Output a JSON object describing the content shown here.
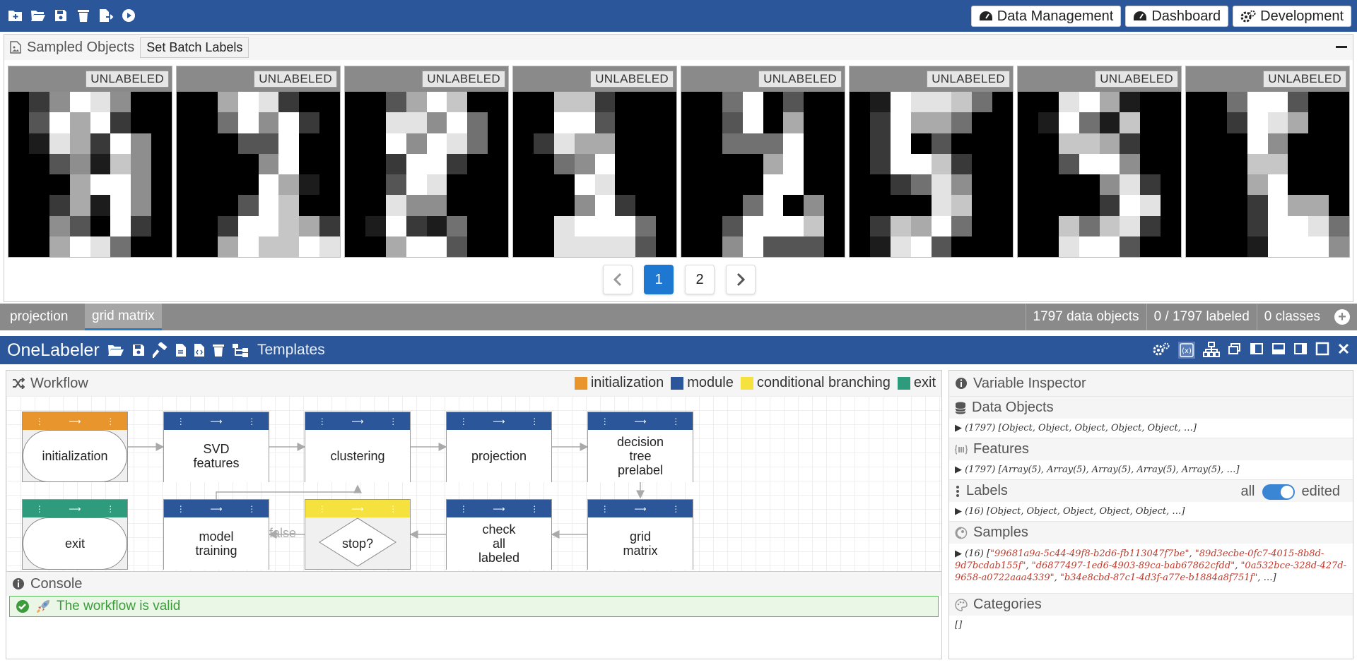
{
  "topbar": {
    "tool_icons": [
      "new-icon",
      "open-icon",
      "save-icon",
      "delete-icon",
      "export-icon",
      "run-icon"
    ],
    "nav": [
      {
        "label": "Data Management",
        "icon": "tachometer-icon"
      },
      {
        "label": "Dashboard",
        "icon": "tachometer-icon"
      },
      {
        "label": "Development",
        "icon": "cogs-icon"
      }
    ]
  },
  "sampled": {
    "title": "Sampled Objects",
    "batch_label": "Set Batch Labels",
    "card_badge": "UNLABELED",
    "pagination": {
      "pages": [
        "1",
        "2"
      ],
      "current": "1"
    },
    "images": [
      [
        0,
        2,
        5,
        9,
        8,
        5,
        0,
        0,
        0,
        3,
        9,
        6,
        9,
        2,
        0,
        0,
        0,
        1,
        8,
        6,
        2,
        9,
        5,
        0,
        0,
        0,
        3,
        5,
        1,
        7,
        5,
        0,
        0,
        0,
        0,
        6,
        9,
        9,
        5,
        0,
        0,
        0,
        2,
        6,
        1,
        9,
        5,
        0,
        0,
        0,
        5,
        3,
        0,
        9,
        2,
        0,
        0,
        0,
        6,
        9,
        8,
        4,
        0,
        0
      ],
      [
        0,
        0,
        6,
        9,
        8,
        2,
        0,
        0,
        0,
        0,
        4,
        9,
        5,
        9,
        2,
        0,
        0,
        0,
        0,
        3,
        3,
        9,
        0,
        0,
        0,
        0,
        0,
        0,
        5,
        9,
        0,
        0,
        0,
        0,
        0,
        0,
        9,
        6,
        1,
        0,
        0,
        0,
        0,
        3,
        9,
        7,
        0,
        0,
        0,
        0,
        2,
        9,
        9,
        7,
        6,
        2,
        0,
        0,
        6,
        9,
        7,
        7,
        9,
        8
      ],
      [
        0,
        0,
        3,
        6,
        9,
        7,
        0,
        0,
        0,
        0,
        8,
        8,
        5,
        9,
        4,
        0,
        0,
        0,
        9,
        5,
        9,
        8,
        4,
        0,
        0,
        0,
        2,
        9,
        9,
        2,
        0,
        0,
        0,
        0,
        3,
        9,
        8,
        0,
        0,
        0,
        0,
        0,
        8,
        5,
        5,
        0,
        0,
        0,
        0,
        1,
        9,
        2,
        1,
        4,
        0,
        0,
        0,
        0,
        6,
        9,
        9,
        3,
        0,
        0
      ],
      [
        0,
        0,
        7,
        7,
        2,
        0,
        0,
        0,
        0,
        0,
        9,
        9,
        3,
        0,
        0,
        0,
        0,
        2,
        8,
        6,
        6,
        0,
        0,
        0,
        0,
        0,
        4,
        5,
        9,
        0,
        0,
        0,
        0,
        0,
        0,
        9,
        8,
        0,
        0,
        0,
        0,
        0,
        0,
        5,
        9,
        2,
        0,
        0,
        0,
        0,
        8,
        9,
        9,
        9,
        4,
        0,
        0,
        0,
        8,
        8,
        8,
        8,
        3,
        0
      ],
      [
        0,
        0,
        4,
        9,
        0,
        3,
        0,
        0,
        0,
        0,
        3,
        9,
        0,
        6,
        0,
        0,
        0,
        0,
        4,
        4,
        4,
        9,
        0,
        0,
        0,
        0,
        0,
        0,
        6,
        9,
        0,
        0,
        0,
        0,
        0,
        0,
        9,
        9,
        0,
        0,
        0,
        0,
        0,
        4,
        9,
        0,
        5,
        0,
        0,
        0,
        3,
        9,
        9,
        9,
        7,
        0,
        0,
        0,
        5,
        9,
        3,
        3,
        3,
        0
      ],
      [
        0,
        1,
        9,
        8,
        8,
        7,
        4,
        0,
        0,
        2,
        9,
        6,
        6,
        4,
        0,
        0,
        0,
        2,
        9,
        0,
        3,
        0,
        0,
        0,
        0,
        2,
        9,
        9,
        7,
        2,
        0,
        0,
        0,
        0,
        2,
        4,
        8,
        5,
        0,
        0,
        0,
        0,
        0,
        0,
        8,
        7,
        0,
        0,
        0,
        2,
        7,
        6,
        9,
        4,
        0,
        0,
        0,
        1,
        8,
        9,
        3,
        0,
        0,
        0
      ],
      [
        0,
        0,
        8,
        9,
        6,
        1,
        0,
        0,
        0,
        1,
        9,
        4,
        1,
        7,
        0,
        0,
        0,
        0,
        7,
        7,
        6,
        2,
        0,
        0,
        0,
        0,
        3,
        9,
        9,
        5,
        0,
        0,
        0,
        0,
        0,
        0,
        5,
        8,
        2,
        0,
        0,
        0,
        0,
        0,
        2,
        9,
        8,
        0,
        0,
        0,
        7,
        4,
        7,
        8,
        2,
        0,
        0,
        0,
        8,
        9,
        9,
        3,
        0,
        0
      ],
      [
        0,
        0,
        4,
        9,
        9,
        3,
        0,
        0,
        0,
        0,
        2,
        9,
        8,
        6,
        0,
        0,
        0,
        0,
        0,
        9,
        5,
        0,
        0,
        0,
        0,
        0,
        0,
        7,
        7,
        0,
        0,
        0,
        0,
        0,
        0,
        6,
        9,
        0,
        0,
        0,
        0,
        0,
        0,
        2,
        9,
        6,
        6,
        0,
        0,
        0,
        0,
        2,
        9,
        9,
        8,
        4,
        0,
        0,
        0,
        1,
        9,
        9,
        9,
        5
      ]
    ]
  },
  "tabs": {
    "items": [
      "projection",
      "grid matrix"
    ],
    "active": "grid matrix",
    "stats": [
      "1797 data objects",
      "0 / 1797 labeled",
      "0 classes"
    ]
  },
  "onelabeler": {
    "title": "OneLabeler",
    "tool_icons": [
      "folder-open-icon",
      "save-icon",
      "hammer-icon",
      "file-icon",
      "code-file-icon",
      "trash-icon",
      "sitemap-icon"
    ],
    "templates_label": "Templates",
    "right_icons": [
      "settings-icon",
      "variable-icon",
      "hierarchy-icon",
      "window-icon",
      "panel-left-icon",
      "panel-bottom-icon",
      "panel-right-icon",
      "maximize-icon",
      "close-icon"
    ]
  },
  "workflow": {
    "title": "Workflow",
    "legend": [
      {
        "label": "initialization",
        "color": "#e8952e"
      },
      {
        "label": "module",
        "color": "#2b579a"
      },
      {
        "label": "conditional branching",
        "color": "#f5e23e"
      },
      {
        "label": "exit",
        "color": "#2e9c7c"
      }
    ],
    "nodes": [
      {
        "label": "initialization",
        "kind": "initialization"
      },
      {
        "label": "SVD\nfeatures",
        "kind": "module"
      },
      {
        "label": "clustering",
        "kind": "module"
      },
      {
        "label": "projection",
        "kind": "module"
      },
      {
        "label": "decision\ntree\nprelabel",
        "kind": "module"
      },
      {
        "label": "exit",
        "kind": "exit"
      },
      {
        "label": "model\ntraining",
        "kind": "module"
      },
      {
        "label": "stop?",
        "kind": "conditional"
      },
      {
        "label": "check\nall\nlabeled",
        "kind": "module"
      },
      {
        "label": "grid\nmatrix",
        "kind": "module"
      }
    ],
    "edge_label_false": "false"
  },
  "console": {
    "title": "Console",
    "message": "The workflow is valid"
  },
  "inspector": {
    "title": "Variable Inspector",
    "sections": [
      {
        "title": "Data Objects",
        "value": "▶ (1797)  [Object, Object, Object, Object, Object, …]"
      },
      {
        "title": "Features",
        "value": "▶ (1797)  [Array(5), Array(5), Array(5), Array(5), Array(5), …]"
      },
      {
        "title": "Labels",
        "value": "▶ (16)  [Object, Object, Object, Object, Object, …]",
        "toggle": {
          "left": "all",
          "right": "edited"
        }
      },
      {
        "title": "Samples",
        "value_prefix": "▶ (16)  [",
        "value_ids": [
          "\"99681a9a-5c44-49f8-b2d6-fb113047f7be\"",
          "\"89d3ecbe-0fc7-4015-8b8d-9d7bcdab155f\"",
          "\"d6877497-1ed6-4903-89ca-bab67862cfdd\"",
          "\"0a532bce-328d-427d-9658-a0722aaa4339\"",
          "\"b34e8cbd-87c1-4d3f-a77e-b1884a8f751f\""
        ],
        "value_suffix": ", …]"
      },
      {
        "title": "Categories",
        "value": "[]"
      }
    ]
  }
}
